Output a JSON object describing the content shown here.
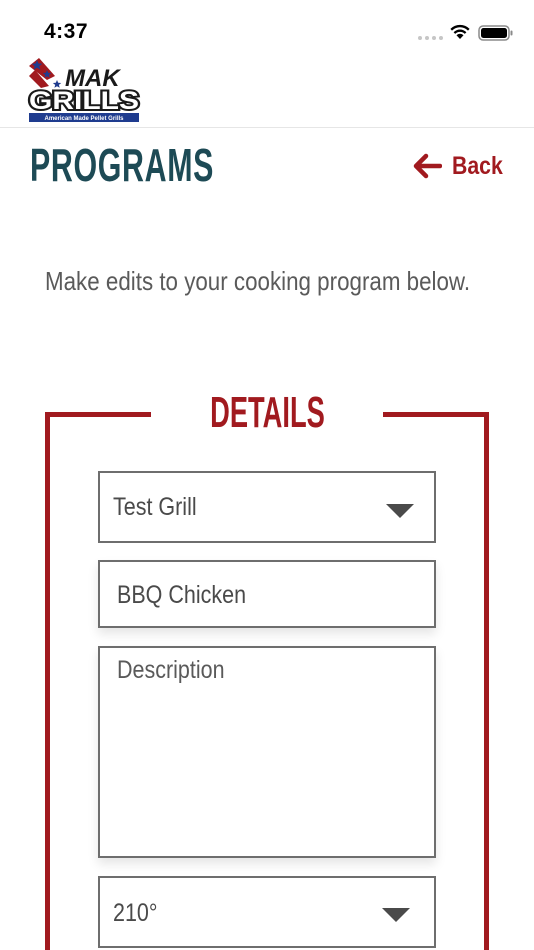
{
  "status_bar": {
    "time": "4:37"
  },
  "header": {
    "logo_top": "MAK",
    "logo_bottom": "GRILLS",
    "logo_tagline": "American Made Pellet Grills"
  },
  "page": {
    "title": "PROGRAMS",
    "back_label": "Back",
    "intro": "Make edits to your cooking program below."
  },
  "details": {
    "heading": "DETAILS",
    "grill_select": {
      "value": "Test Grill"
    },
    "name_input": {
      "value": "BBQ Chicken"
    },
    "description_input": {
      "value": "",
      "placeholder": "Description"
    },
    "temperature_select": {
      "value": "210°"
    }
  },
  "colors": {
    "brand_red": "#a11a1f",
    "title_teal": "#1d4a55",
    "logo_blue": "#1f3c8f"
  }
}
